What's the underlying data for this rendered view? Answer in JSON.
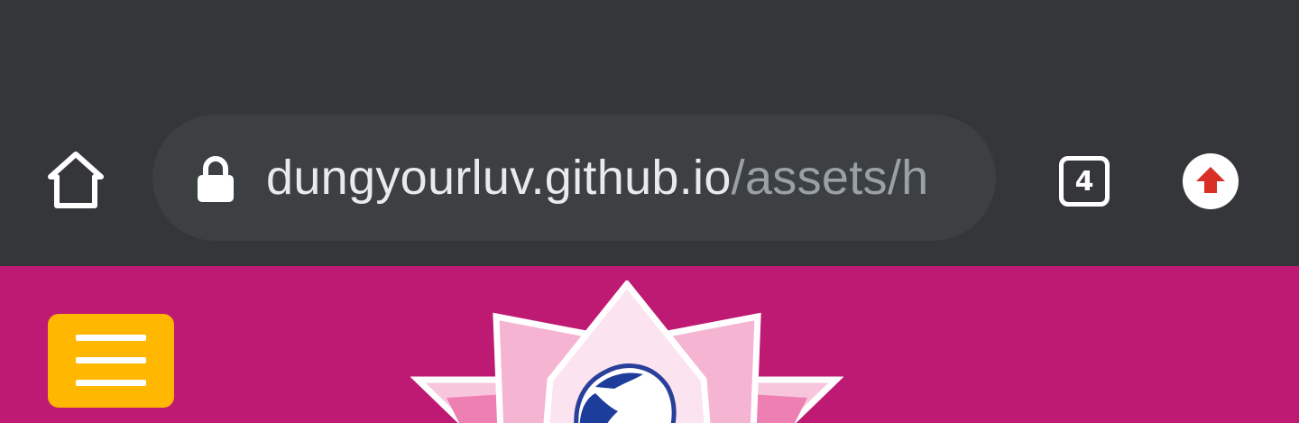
{
  "browser": {
    "address_bar": {
      "host": "dungyourluv.github.io",
      "path": "/assets/h",
      "secure_icon": "lock-icon"
    },
    "tab_count": "4",
    "home_icon": "home-icon",
    "update_icon": "update-available-icon"
  },
  "page": {
    "menu_icon": "hamburger-menu-icon",
    "logo": "lotus-logo"
  },
  "colors": {
    "browser_chrome": "#35363a",
    "omnibox": "#3c4043",
    "url_host": "#e8eaed",
    "url_path": "#9aa0a6",
    "page_background": "#be1a74",
    "menu_button": "#ffb700",
    "update_arrow": "#d93025"
  }
}
